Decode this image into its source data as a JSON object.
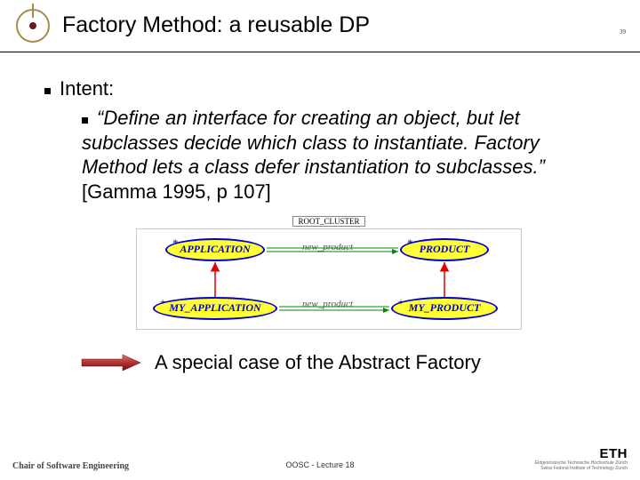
{
  "header": {
    "title": "Factory Method: a reusable DP",
    "page_number": "39"
  },
  "intent": {
    "label": "Intent:",
    "quote": "“Define an interface for creating an object, but let subclasses decide which class to instantiate. Factory Method lets a class defer instantiation to subclasses.”",
    "citation": " [Gamma 1995, p 107]"
  },
  "diagram": {
    "root_label": "ROOT_CLUSTER",
    "classes": {
      "application": "APPLICATION",
      "product": "PRODUCT",
      "my_application": "MY_APPLICATION",
      "my_product": "MY_PRODUCT"
    },
    "edges": {
      "new_product": "new_product",
      "new_product2": "new_product"
    }
  },
  "callout": "A special case of the Abstract Factory",
  "footer": {
    "left": "Chair of Software Engineering",
    "center": "OOSC - Lecture 18",
    "right_brand": "ETH",
    "right_sub1": "Eidgenössische Technische Hochschule Zürich",
    "right_sub2": "Swiss Federal Institute of Technology Zurich"
  }
}
